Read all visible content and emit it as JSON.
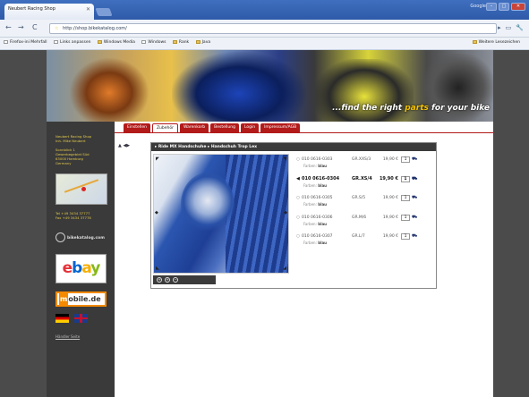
{
  "browser": {
    "tab_title": "Neubert Racing Shop",
    "window_label": "Google",
    "url": "http://shop.bikekatalog.com/",
    "bookmarks": [
      "Firefox-ini Mehrfall",
      "Links anpassen",
      "Windows Media",
      "Windows",
      "Rank",
      "Java"
    ],
    "other_bookmarks": "Weitere Lesezeichen"
  },
  "site": {
    "slogan_part1": "...find the right ",
    "slogan_highlight": "parts",
    "slogan_part2": " for your bike",
    "nav_tabs": [
      "Einstellen",
      "Zubehör",
      "Warenkorb",
      "Bestellung",
      "Login",
      "Impressum/AGB"
    ],
    "active_tab": "Zubehör",
    "sidebar": {
      "address": [
        "Neubert Racing Shop",
        "Inh. Mike Neubert",
        "",
        "Sonnblick 1",
        "Gewerbegebiet Süd",
        "63000 Hamburg",
        "Germany"
      ],
      "phone": [
        "Tel +49 3434 37777",
        "Fax +49 3434 37778"
      ],
      "tk_logo_text": "bikekatalog.com",
      "mobile_label": "mobile.de",
      "international_link": "Händler Seite"
    },
    "breadcrumb": "▸ Ride MX Handschuhe  ▸ Handschuh Trop Lex",
    "items": [
      {
        "code": "010 0616-0303",
        "model": "GR.XXS/3",
        "price": "19,90 €",
        "qty": "1",
        "farben_label": "Farben:",
        "farben": "blau",
        "selected": false
      },
      {
        "code": "010 0616-0304",
        "model": "GR.XS/4",
        "price": "19,90 €",
        "qty": "1",
        "farben_label": "Farben:",
        "farben": "blau",
        "selected": true
      },
      {
        "code": "010 0616-0305",
        "model": "GR.S/5",
        "price": "19,90 €",
        "qty": "1",
        "farben_label": "Farben:",
        "farben": "blau",
        "selected": false
      },
      {
        "code": "010 0616-0306",
        "model": "GR.M/6",
        "price": "19,90 €",
        "qty": "1",
        "farben_label": "Farben:",
        "farben": "blau",
        "selected": false
      },
      {
        "code": "010 0616-0307",
        "model": "GR.L/7",
        "price": "19,90 €",
        "qty": "1",
        "farben_label": "Farben:",
        "farben": "blau",
        "selected": false
      }
    ]
  }
}
